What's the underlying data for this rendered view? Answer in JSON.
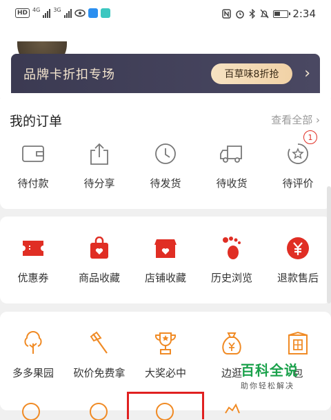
{
  "status_bar": {
    "hd": "HD",
    "net1": "4G",
    "net2": "3G",
    "time": "2:34"
  },
  "brand_banner": {
    "title": "品牌卡折扣专场",
    "button": "百草味8折抢",
    "arrow": "›"
  },
  "orders": {
    "title": "我的订单",
    "view_all": "查看全部 ›",
    "items": [
      {
        "label": "待付款",
        "icon": "wallet-icon"
      },
      {
        "label": "待分享",
        "icon": "share-icon"
      },
      {
        "label": "待发货",
        "icon": "clock-icon"
      },
      {
        "label": "待收货",
        "icon": "truck-icon"
      },
      {
        "label": "待评价",
        "icon": "review-icon",
        "badge": "1"
      }
    ]
  },
  "tools": {
    "items": [
      {
        "label": "优惠券",
        "icon": "coupon-icon"
      },
      {
        "label": "商品收藏",
        "icon": "bag-heart-icon"
      },
      {
        "label": "店铺收藏",
        "icon": "store-heart-icon"
      },
      {
        "label": "历史浏览",
        "icon": "footprint-icon"
      },
      {
        "label": "退款售后",
        "icon": "yen-icon"
      }
    ]
  },
  "games": {
    "items": [
      {
        "label": "多多果园",
        "icon": "tree-icon"
      },
      {
        "label": "砍价免费拿",
        "icon": "axe-icon"
      },
      {
        "label": "大奖必中",
        "icon": "trophy-icon"
      },
      {
        "label": "边逛",
        "icon": "money-bag-icon"
      },
      {
        "label": "包",
        "icon": "fu-icon"
      }
    ]
  },
  "watermark": {
    "title": "百科全说",
    "subtitle": "助你轻松解决"
  },
  "colors": {
    "accent": "#e02e24",
    "game_icon": "#f08a24",
    "banner_bg": "#3f3e58",
    "banner_button": "#f3dab5"
  }
}
